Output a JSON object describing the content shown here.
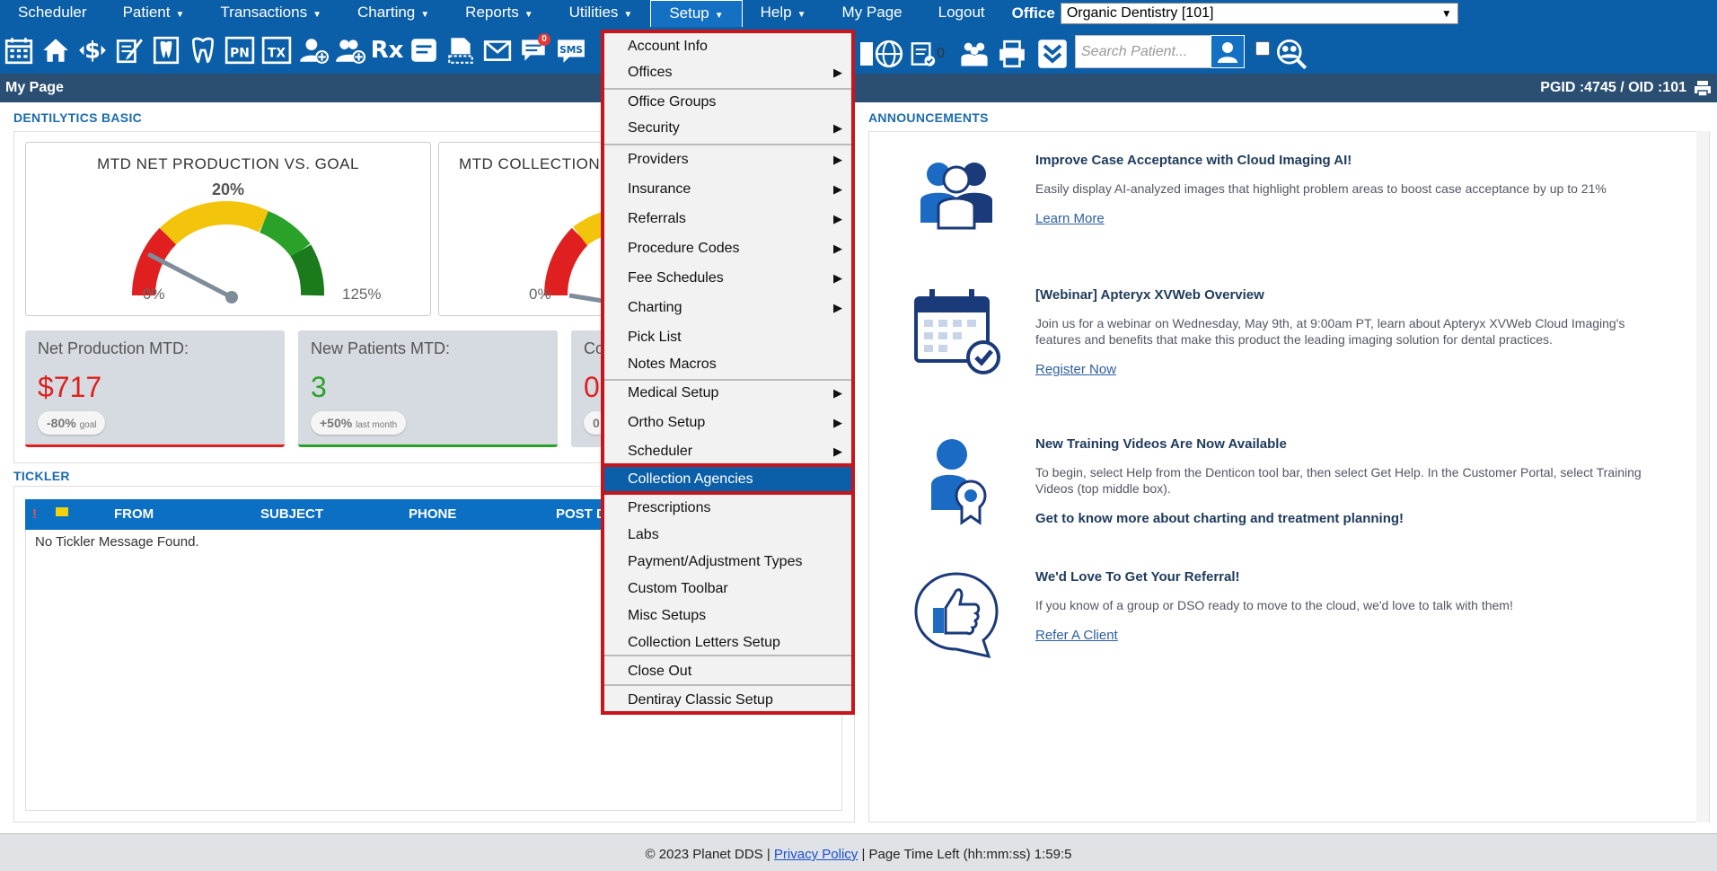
{
  "topnav": {
    "items": [
      {
        "label": "Scheduler",
        "caret": false
      },
      {
        "label": "Patient",
        "caret": true
      },
      {
        "label": "Transactions",
        "caret": true
      },
      {
        "label": "Charting",
        "caret": true
      },
      {
        "label": "Reports",
        "caret": true
      },
      {
        "label": "Utilities",
        "caret": true
      },
      {
        "label": "Setup",
        "caret": true
      },
      {
        "label": "Help",
        "caret": true
      },
      {
        "label": "My Page",
        "caret": false
      },
      {
        "label": "Logout",
        "caret": false
      }
    ],
    "office_label": "Office",
    "office_value": "Organic Dentistry [101]"
  },
  "toolbar": {
    "search_placeholder": "Search Patient...",
    "badge_count_1": "0",
    "badge_count_2": "0",
    "pn": "PN",
    "tx": "TX",
    "rx": "Rx",
    "sms": "SMS"
  },
  "pagebar": {
    "title": "My Page",
    "ids": "PGID :4745  /  OID :101"
  },
  "dentilytics": {
    "section_title": "DENTILYTICS BASIC",
    "gauge1": {
      "title": "MTD NET PRODUCTION VS. GOAL",
      "percent": "20%",
      "min": "0%",
      "max": "125%",
      "value": 0.16
    },
    "gauge2": {
      "title": "MTD COLLECTION",
      "min": "0%"
    },
    "stat1": {
      "label": "Net Production MTD:",
      "value": "$717",
      "pill": "-80%",
      "pill_suffix": "goal"
    },
    "stat2": {
      "label": "New Patients MTD:",
      "value": "3",
      "pill": "+50%",
      "pill_suffix": "last month"
    },
    "stat3": {
      "label": "Co",
      "value": "0",
      "pill": "0"
    }
  },
  "tickler": {
    "section_title": "TICKLER",
    "columns": [
      "!",
      "FROM",
      "SUBJECT",
      "PHONE",
      "POST D"
    ],
    "empty_text": "No Tickler Message Found."
  },
  "announcements": {
    "section_title": "ANNOUNCEMENTS",
    "items": [
      {
        "title": "Improve Case Acceptance with Cloud Imaging AI!",
        "desc": "Easily display AI-analyzed images that highlight problem areas to boost case acceptance by up to 21%",
        "link": "Learn More"
      },
      {
        "title": "[Webinar] Apteryx XVWeb Overview",
        "desc": "Join us for a webinar on Wednesday, May 9th, at 9:00am PT, learn about Apteryx XVWeb Cloud Imaging's features and benefits that make this product the leading imaging solution for dental practices.",
        "link": "Register Now"
      },
      {
        "title": "New Training Videos Are Now Available",
        "desc": "To begin, select Help from the Denticon tool bar, then select Get Help. In the Customer Portal, select Training Videos (top middle box).",
        "bold": "Get to know more about charting and treatment planning!"
      },
      {
        "title": "We'd Love To Get Your Referral!",
        "desc": "If you know of a group or DSO ready to move to the cloud, we'd love to talk with them!",
        "link": "Refer A Client"
      }
    ]
  },
  "setup_menu": {
    "items": [
      {
        "label": "Account Info",
        "sub": false
      },
      {
        "label": "Offices",
        "sub": true
      },
      {
        "label": "Office Groups",
        "sub": false
      },
      {
        "label": "Security",
        "sub": true
      },
      {
        "label": "Providers",
        "sub": true
      },
      {
        "label": "Insurance",
        "sub": true
      },
      {
        "label": "Referrals",
        "sub": true
      },
      {
        "label": "Procedure Codes",
        "sub": true
      },
      {
        "label": "Fee Schedules",
        "sub": true
      },
      {
        "label": "Charting",
        "sub": true
      },
      {
        "label": "Pick List",
        "sub": false
      },
      {
        "label": "Notes Macros",
        "sub": false
      },
      {
        "label": "Medical Setup",
        "sub": true
      },
      {
        "label": "Ortho Setup",
        "sub": true
      },
      {
        "label": "Scheduler",
        "sub": true
      },
      {
        "label": "Collection Agencies",
        "sub": false
      },
      {
        "label": "Prescriptions",
        "sub": false
      },
      {
        "label": "Labs",
        "sub": false
      },
      {
        "label": "Payment/Adjustment Types",
        "sub": false
      },
      {
        "label": "Custom Toolbar",
        "sub": false
      },
      {
        "label": "Misc Setups",
        "sub": false
      },
      {
        "label": "Collection Letters Setup",
        "sub": false
      },
      {
        "label": "Close Out",
        "sub": false
      },
      {
        "label": "Dentiray Classic Setup",
        "sub": false
      }
    ]
  },
  "footer": {
    "copyright": "© 2023 Planet DDS |",
    "privacy": "Privacy Policy",
    "time_left": "|  Page Time Left (hh:mm:ss) 1:59:5"
  },
  "colors": {
    "nav": "#0b5fa8",
    "highlight_border": "#c8141b",
    "red": "#e02020",
    "green": "#2aa22a"
  }
}
